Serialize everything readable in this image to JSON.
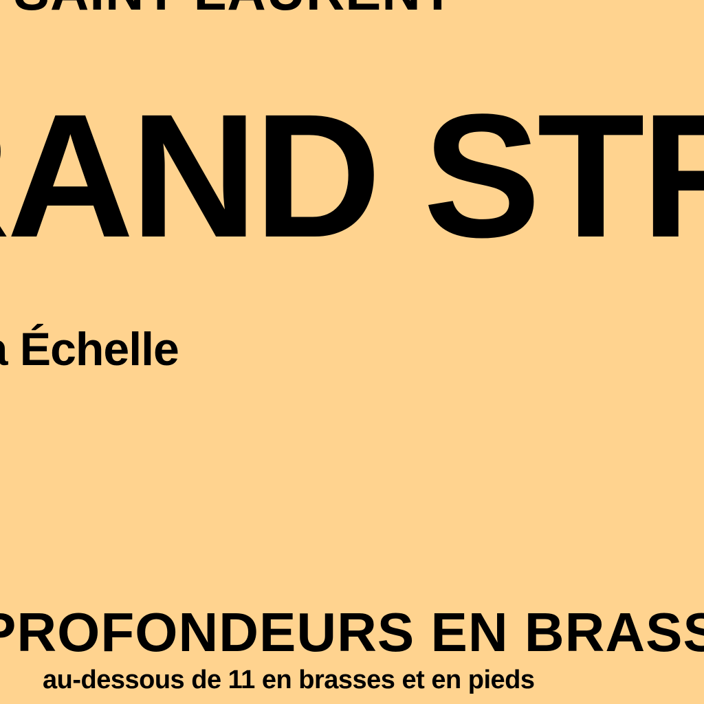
{
  "map": {
    "background_color": "#ffd38f",
    "text_color": "#000000",
    "top_heading": "D SAINT-LAURENT",
    "main_title": "RAND STRAIT",
    "scale_label": "à Échelle",
    "depth_heading": "PROFONDEURS EN BRASSES",
    "depth_subtitle": "au-dessous de 11 en brasses et en pieds"
  }
}
